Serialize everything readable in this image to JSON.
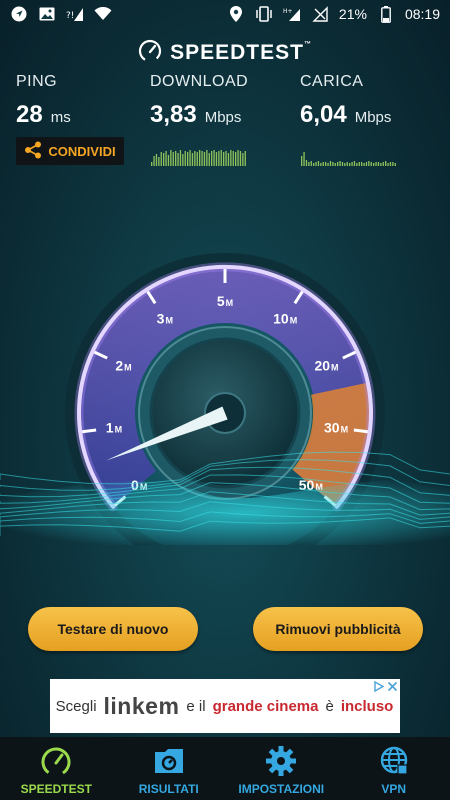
{
  "status_bar": {
    "battery": "21%",
    "time": "08:19"
  },
  "header": {
    "app_name": "SPEEDTEST",
    "tm": "™"
  },
  "metrics": {
    "ping": {
      "label": "PING",
      "value": "28",
      "unit": "ms"
    },
    "download": {
      "label": "DOWNLOAD",
      "value": "3,83",
      "unit": "Mbps"
    },
    "upload": {
      "label": "CARICA",
      "value": "6,04",
      "unit": "Mbps"
    }
  },
  "share_button": {
    "label": "CONDIVIDI"
  },
  "gauge": {
    "ticks": [
      {
        "num": "0",
        "unit": "M"
      },
      {
        "num": "1",
        "unit": "M"
      },
      {
        "num": "2",
        "unit": "M"
      },
      {
        "num": "3",
        "unit": "M"
      },
      {
        "num": "5",
        "unit": "M"
      },
      {
        "num": "10",
        "unit": "M"
      },
      {
        "num": "20",
        "unit": "M"
      },
      {
        "num": "30",
        "unit": "M"
      },
      {
        "num": "50",
        "unit": "M"
      }
    ]
  },
  "buttons": {
    "retest": "Testare di nuovo",
    "remove_ads": "Rimuovi pubblicità"
  },
  "ad": {
    "text1": "Scegli",
    "brand": "linkem",
    "text2": "e il",
    "highlight1": "grande cinema",
    "text3": "è",
    "highlight2": "incluso"
  },
  "nav": {
    "items": [
      {
        "label": "SPEEDTEST",
        "icon": "speedometer-icon",
        "active": true
      },
      {
        "label": "RISULTATI",
        "icon": "folder-results-icon",
        "active": false
      },
      {
        "label": "IMPOSTAZIONI",
        "icon": "gear-icon",
        "active": false
      },
      {
        "label": "VPN",
        "icon": "globe-icon",
        "active": false
      }
    ]
  },
  "colors": {
    "accent_orange": "#f5a623",
    "nav_blue": "#35a7e1",
    "nav_active": "#9bd94d",
    "gauge_purple": "#8f6bd8",
    "graph_green": "#8fc25a"
  }
}
